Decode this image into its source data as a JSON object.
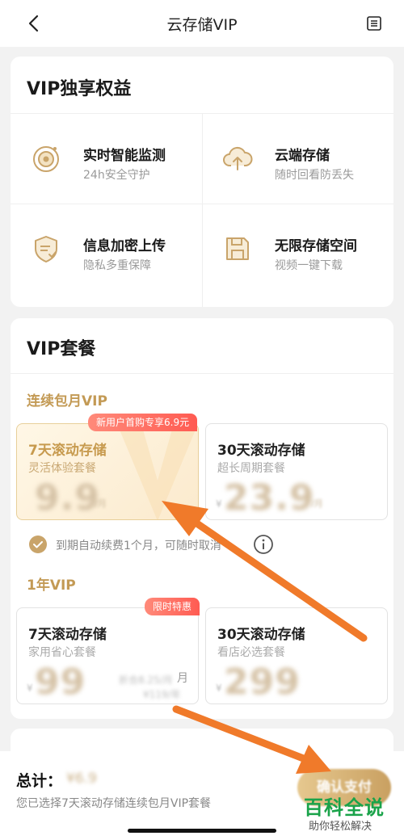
{
  "header": {
    "title": "云存储VIP",
    "back_icon": "chevron-left-icon",
    "menu_icon": "list-document-icon"
  },
  "benefits": {
    "title": "VIP独享权益",
    "items": [
      {
        "name": "实时智能监测",
        "desc": "24h安全守护",
        "icon": "monitor-eye-icon"
      },
      {
        "name": "云端存储",
        "desc": "随时回看防丢失",
        "icon": "cloud-upload-icon"
      },
      {
        "name": "信息加密上传",
        "desc": "隐私多重保障",
        "icon": "shield-check-icon"
      },
      {
        "name": "无限存储空间",
        "desc": "视频一键下载",
        "icon": "floppy-disk-icon"
      }
    ]
  },
  "plans": {
    "title": "VIP套餐",
    "monthly": {
      "label": "连续包月VIP",
      "items": [
        {
          "name": "7天滚动存储",
          "sub": "灵活体验套餐",
          "badge": "新用户首购专享6.9元",
          "price": "9.9",
          "unit": "/月",
          "selected": true
        },
        {
          "name": "30天滚动存储",
          "sub": "超长周期套餐",
          "currency": "¥",
          "price": "23.9",
          "unit": "/月",
          "selected": false
        }
      ]
    },
    "renew_note": "到期自动续费1个月，可随时取消",
    "yearly": {
      "label": "1年VIP",
      "items": [
        {
          "name": "7天滚动存储",
          "sub": "家用省心套餐",
          "badge": "限时特惠",
          "currency": "¥",
          "price": "99",
          "orig": "折合8.25/月",
          "per_month": "月",
          "per_year": "¥119/年"
        },
        {
          "name": "30天滚动存储",
          "sub": "看店必选套餐",
          "currency": "¥",
          "price": "299"
        }
      ]
    }
  },
  "footer": {
    "total_label": "总计：",
    "total_amount": "¥6.9",
    "selected_note": "您已选择7天滚动存储连续包月VIP套餐",
    "pay_button": "确认支付"
  },
  "watermark": {
    "main": "百科全说",
    "sub": "助你轻松解决"
  },
  "colors": {
    "gold": "#c39a55",
    "badge_red": "#ff5b52",
    "arrow_orange": "#f07a2a",
    "watermark_green": "#1aa34a"
  }
}
